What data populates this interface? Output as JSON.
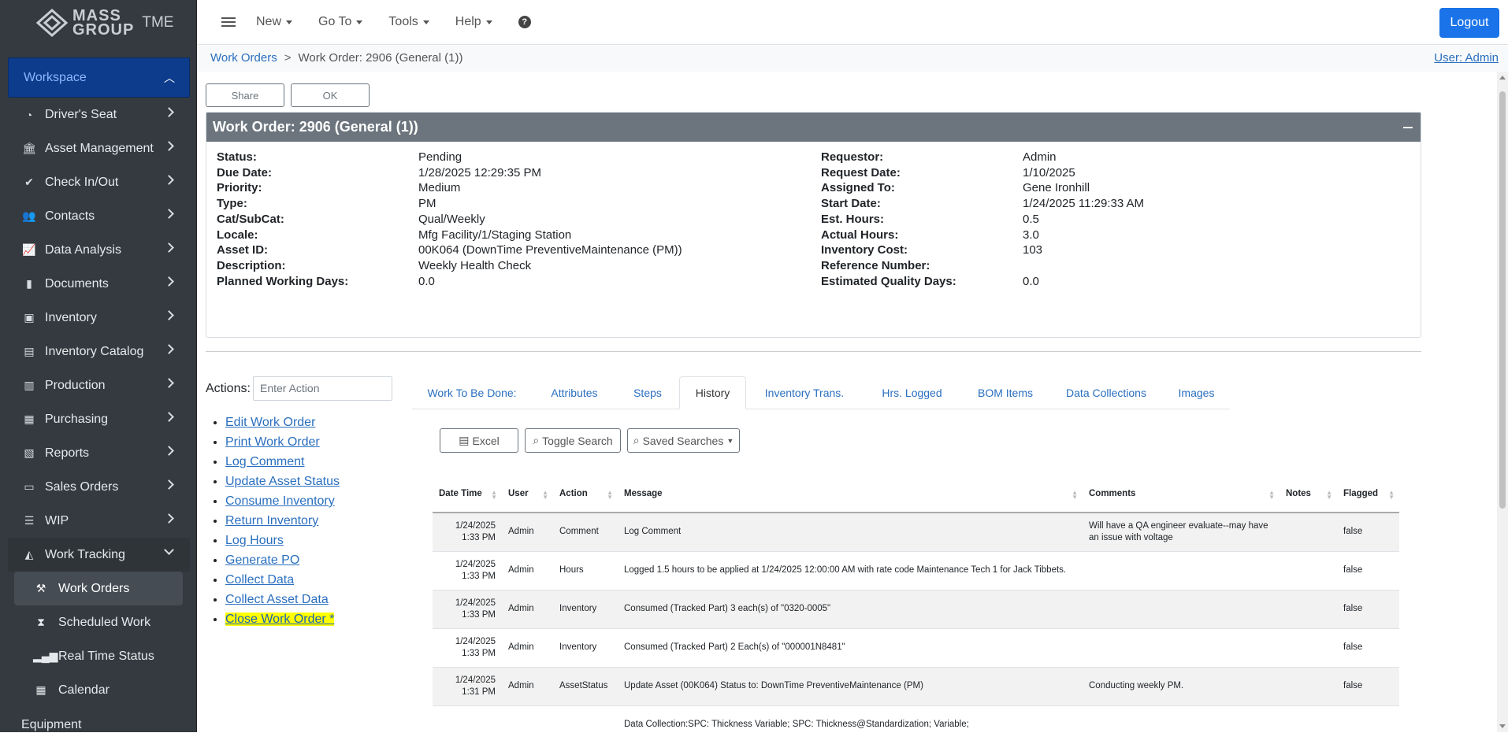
{
  "brand": {
    "name": "MASS",
    "sub1": "GROUP",
    "sub2": "TME"
  },
  "sidebar": {
    "workspace": "Workspace",
    "items": [
      {
        "label": "Driver's Seat",
        "icon": "gauge-icon"
      },
      {
        "label": "Asset Management",
        "icon": "bank-icon"
      },
      {
        "label": "Check In/Out",
        "icon": "double-check-icon"
      },
      {
        "label": "Contacts",
        "icon": "users-icon"
      },
      {
        "label": "Data Analysis",
        "icon": "line-chart-icon"
      },
      {
        "label": "Documents",
        "icon": "file-icon"
      },
      {
        "label": "Inventory",
        "icon": "box-icon"
      },
      {
        "label": "Inventory Catalog",
        "icon": "book-icon"
      },
      {
        "label": "Production",
        "icon": "building-icon"
      },
      {
        "label": "Purchasing",
        "icon": "cash-register-icon"
      },
      {
        "label": "Reports",
        "icon": "report-icon"
      },
      {
        "label": "Sales Orders",
        "icon": "credit-card-icon"
      },
      {
        "label": "WIP",
        "icon": "list-icon"
      },
      {
        "label": "Work Tracking",
        "icon": "area-chart-icon"
      }
    ],
    "subitems": [
      {
        "label": "Work Orders",
        "icon": "hammer-icon"
      },
      {
        "label": "Scheduled Work",
        "icon": "hourglass-icon"
      },
      {
        "label": "Real Time Status",
        "icon": "signal-icon"
      },
      {
        "label": "Calendar",
        "icon": "calendar-icon"
      }
    ],
    "partial": "Equipment"
  },
  "topbar": {
    "new": "New",
    "goto": "Go To",
    "tools": "Tools",
    "help": "Help",
    "logout": "Logout"
  },
  "breadcrumb": {
    "root": "Work Orders",
    "sep": ">",
    "current": "Work Order: 2906 (General (1))",
    "user": "User: Admin"
  },
  "buttons": {
    "share": "Share",
    "ok": "OK"
  },
  "card": {
    "title": "Work Order: 2906 (General (1))",
    "left": [
      {
        "label": "Status:",
        "value": "Pending"
      },
      {
        "label": "Due Date:",
        "value": "1/28/2025 12:29:35 PM"
      },
      {
        "label": "Priority:",
        "value": "Medium"
      },
      {
        "label": "Type:",
        "value": "PM"
      },
      {
        "label": "Cat/SubCat:",
        "value": "Qual/Weekly"
      },
      {
        "label": "Locale:",
        "value": "Mfg Facility/1/Staging Station"
      },
      {
        "label": "Asset ID:",
        "value": "00K064 (DownTime PreventiveMaintenance (PM))"
      },
      {
        "label": "Description:",
        "value": "Weekly Health Check"
      },
      {
        "label": "Planned Working Days:",
        "value": "0.0"
      }
    ],
    "right": [
      {
        "label": "Requestor:",
        "value": "Admin"
      },
      {
        "label": "Request Date:",
        "value": "1/10/2025"
      },
      {
        "label": "Assigned To:",
        "value": "Gene Ironhill"
      },
      {
        "label": "Start Date:",
        "value": "1/24/2025 11:29:33 AM"
      },
      {
        "label": "Est. Hours:",
        "value": "0.5"
      },
      {
        "label": "Actual Hours:",
        "value": "3.0"
      },
      {
        "label": "Inventory Cost:",
        "value": "103"
      },
      {
        "label": "Reference Number:",
        "value": ""
      },
      {
        "label": "Estimated Quality Days:",
        "value": "0.0"
      }
    ]
  },
  "actions": {
    "label": "Actions:",
    "placeholder": "Enter Action",
    "links": [
      "Edit Work Order",
      "Print Work Order",
      "Log Comment",
      "Update Asset Status",
      "Consume Inventory",
      "Return Inventory",
      "Log Hours",
      "Generate PO",
      "Collect Data",
      "Collect Asset Data",
      "Close Work Order *"
    ]
  },
  "tabs": [
    "Work To Be Done:",
    "Attributes",
    "Steps",
    "History",
    "Inventory Trans.",
    "Hrs. Logged",
    "BOM Items",
    "Data Collections",
    "Images"
  ],
  "grid_buttons": {
    "excel": "Excel",
    "toggle": "Toggle Search",
    "saved": "Saved Searches"
  },
  "table": {
    "headers": [
      "Date Time",
      "User",
      "Action",
      "Message",
      "Comments",
      "Notes",
      "Flagged"
    ],
    "rows": [
      {
        "date": "1/24/2025",
        "time": "1:33 PM",
        "user": "Admin",
        "action": "Comment",
        "message": "Log Comment",
        "comments": "Will have a QA engineer evaluate--may have an issue with voltage",
        "notes": "",
        "flagged": "false"
      },
      {
        "date": "1/24/2025",
        "time": "1:33 PM",
        "user": "Admin",
        "action": "Hours",
        "message": "Logged 1.5 hours to be applied at 1/24/2025 12:00:00 AM with rate code Maintenance Tech 1 for Jack Tibbets.",
        "comments": "",
        "notes": "",
        "flagged": "false"
      },
      {
        "date": "1/24/2025",
        "time": "1:33 PM",
        "user": "Admin",
        "action": "Inventory",
        "message": "Consumed (Tracked Part) 3 each(s) of \"0320-0005\"",
        "comments": "",
        "notes": "",
        "flagged": "false"
      },
      {
        "date": "1/24/2025",
        "time": "1:33 PM",
        "user": "Admin",
        "action": "Inventory",
        "message": "Consumed (Tracked Part) 2 Each(s) of \"000001N8481\"",
        "comments": "",
        "notes": "",
        "flagged": "false"
      },
      {
        "date": "1/24/2025",
        "time": "1:31 PM",
        "user": "Admin",
        "action": "AssetStatus",
        "message": "Update Asset (00K064) Status to: DownTime PreventiveMaintenance (PM)",
        "comments": "Conducting weekly PM.",
        "notes": "",
        "flagged": "false"
      },
      {
        "date": "",
        "time": "",
        "user": "",
        "action": "",
        "message": "Data Collection:SPC: Thickness Variable; SPC: Thickness@Standardization; Variable;",
        "comments": "",
        "notes": "",
        "flagged": ""
      }
    ]
  }
}
